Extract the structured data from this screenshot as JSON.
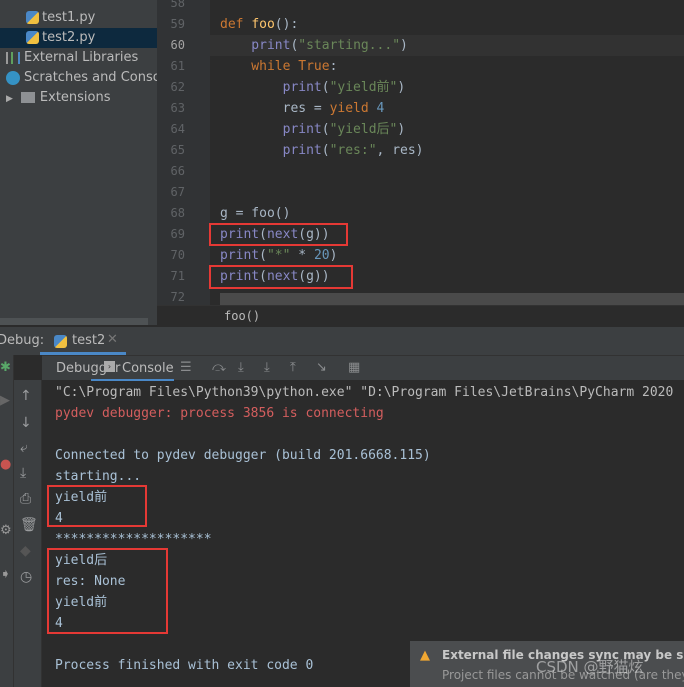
{
  "project_tree": {
    "items": [
      {
        "label": "test1.py",
        "icon": "python-file-icon"
      },
      {
        "label": "test2.py",
        "icon": "python-file-icon",
        "selected": true
      },
      {
        "label": "External Libraries",
        "icon": "libraries-icon"
      },
      {
        "label": "Scratches and Consoles",
        "icon": "scratches-icon"
      },
      {
        "label": "Extensions",
        "icon": "folder-icon"
      }
    ]
  },
  "editor": {
    "line_numbers": [
      "58",
      "59",
      "60",
      "61",
      "62",
      "63",
      "64",
      "65",
      "66",
      "67",
      "68",
      "69",
      "70",
      "71",
      "72"
    ],
    "current_line": "60",
    "lines": [
      [],
      [
        {
          "t": "def ",
          "c": "#cc7832"
        },
        {
          "t": "foo",
          "c": "#ffc66d"
        },
        {
          "t": "():",
          "c": "#a9b7c6"
        }
      ],
      [
        {
          "t": "    print",
          "c": "#8888c6"
        },
        {
          "t": "(",
          "c": "#a9b7c6"
        },
        {
          "t": "\"starting...\"",
          "c": "#6a8759"
        },
        {
          "t": ")",
          "c": "#a9b7c6"
        }
      ],
      [
        {
          "t": "    while ",
          "c": "#cc7832"
        },
        {
          "t": "True",
          "c": "#cc7832"
        },
        {
          "t": ":",
          "c": "#a9b7c6"
        }
      ],
      [
        {
          "t": "        print",
          "c": "#8888c6"
        },
        {
          "t": "(",
          "c": "#a9b7c6"
        },
        {
          "t": "\"yield前\"",
          "c": "#6a8759"
        },
        {
          "t": ")",
          "c": "#a9b7c6"
        }
      ],
      [
        {
          "t": "        res = ",
          "c": "#a9b7c6"
        },
        {
          "t": "yield ",
          "c": "#cc7832"
        },
        {
          "t": "4",
          "c": "#6897bb"
        }
      ],
      [
        {
          "t": "        print",
          "c": "#8888c6"
        },
        {
          "t": "(",
          "c": "#a9b7c6"
        },
        {
          "t": "\"yield后\"",
          "c": "#6a8759"
        },
        {
          "t": ")",
          "c": "#a9b7c6"
        }
      ],
      [
        {
          "t": "        print",
          "c": "#8888c6"
        },
        {
          "t": "(",
          "c": "#a9b7c6"
        },
        {
          "t": "\"res:\"",
          "c": "#6a8759"
        },
        {
          "t": ", res)",
          "c": "#a9b7c6"
        }
      ],
      [],
      [],
      [
        {
          "t": "g = foo()",
          "c": "#a9b7c6"
        }
      ],
      [
        {
          "t": "print",
          "c": "#8888c6"
        },
        {
          "t": "(",
          "c": "#a9b7c6"
        },
        {
          "t": "next",
          "c": "#8888c6"
        },
        {
          "t": "(g))",
          "c": "#a9b7c6"
        }
      ],
      [
        {
          "t": "print",
          "c": "#8888c6"
        },
        {
          "t": "(",
          "c": "#a9b7c6"
        },
        {
          "t": "\"*\"",
          "c": "#6a8759"
        },
        {
          "t": " * ",
          "c": "#a9b7c6"
        },
        {
          "t": "20",
          "c": "#6897bb"
        },
        {
          "t": ")",
          "c": "#a9b7c6"
        }
      ],
      [
        {
          "t": "print",
          "c": "#8888c6"
        },
        {
          "t": "(",
          "c": "#a9b7c6"
        },
        {
          "t": "next",
          "c": "#8888c6"
        },
        {
          "t": "(g))",
          "c": "#a9b7c6"
        }
      ],
      []
    ],
    "breadcrumb": "foo()"
  },
  "debug": {
    "label": "Debug:",
    "tab": "test2",
    "subtabs": [
      "Debugger",
      "Console"
    ],
    "active_subtab": "Console"
  },
  "console": {
    "lines": [
      {
        "t": "\"C:\\Program Files\\Python39\\python.exe\" \"D:\\Program Files\\JetBrains\\PyCharm 2020",
        "c": "#bbbbbb"
      },
      {
        "t": "pydev debugger: process 3856 is connecting",
        "c": "#d45e5e"
      },
      {
        "t": "",
        "c": "#bbbbbb"
      },
      {
        "t": "Connected to pydev debugger (build 201.6668.115)",
        "c": "#a9c1d6"
      },
      {
        "t": "starting...",
        "c": "#a9c1d6"
      },
      {
        "t": "yield前",
        "c": "#a9c1d6"
      },
      {
        "t": "4",
        "c": "#a9c1d6"
      },
      {
        "t": "********************",
        "c": "#a9c1d6"
      },
      {
        "t": "yield后",
        "c": "#a9c1d6"
      },
      {
        "t": "res: None",
        "c": "#a9c1d6"
      },
      {
        "t": "yield前",
        "c": "#a9c1d6"
      },
      {
        "t": "4",
        "c": "#a9c1d6"
      },
      {
        "t": "",
        "c": "#bbbbbb"
      },
      {
        "t": "Process finished with exit code 0",
        "c": "#a9c1d6"
      }
    ]
  },
  "notification": {
    "title": "External file changes sync may be slow",
    "body": "Project files cannot be watched (are they",
    "icon": "warning-icon",
    "watermark": "CSDN @野猫炫"
  },
  "colors": {
    "highlight_box": "#e53935",
    "selection": "#0d293e",
    "accent": "#4a88c7"
  }
}
